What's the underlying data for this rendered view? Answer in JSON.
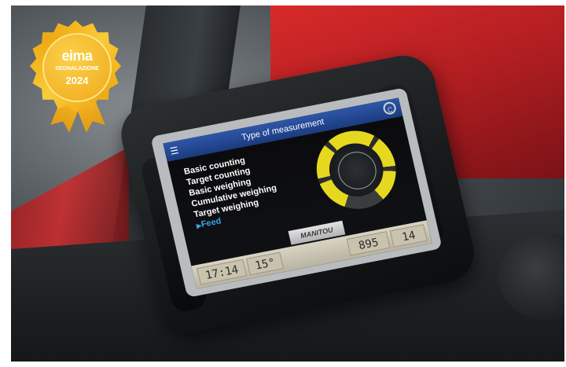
{
  "badge": {
    "logo_text": "eima",
    "label": "SEGNALAZIONE",
    "year": "2024"
  },
  "screen": {
    "title": "Type of measurement",
    "menu_icon": "hamburger-menu-icon",
    "settings_icon": "settings-icon",
    "items": [
      {
        "label": "Basic counting",
        "active": false
      },
      {
        "label": "Target counting",
        "active": false
      },
      {
        "label": "Basic weighing",
        "active": false
      },
      {
        "label": "Cumulative weighing",
        "active": false
      },
      {
        "label": "Target weighing",
        "active": false
      },
      {
        "label": "Feed",
        "active": true
      }
    ],
    "brand": "MANITOU",
    "status": {
      "time": "17:14",
      "temperature": "15°",
      "reading_a": "895",
      "reading_b": "14"
    }
  },
  "colors": {
    "header": "#1b3b7e",
    "gauge": "#e6d81f",
    "active_item": "#3aa3e3",
    "badge": "#f5b820"
  }
}
